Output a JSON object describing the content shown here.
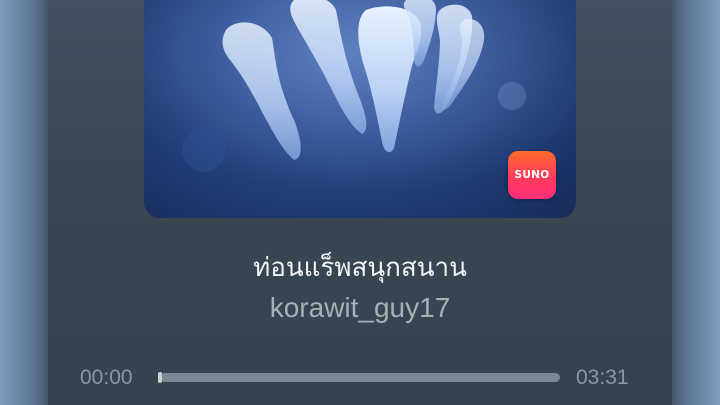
{
  "player": {
    "song_title": "ท่อนแร็พสนุกสนาน",
    "artist": "korawit_guy17",
    "time_current": "00:00",
    "time_total": "03:31",
    "progress_fraction": 0.0,
    "badge_label": "SUNO"
  },
  "colors": {
    "panel": "#3a4653",
    "artwork_base": "#2a4a8c",
    "badge_top": "#ff6a2b",
    "badge_bottom": "#ff2f78",
    "title_text": "#f1f3f6",
    "artist_text": "#a7afb9",
    "track": "#7d8793"
  },
  "icons": {
    "artwork": "teeth-xray-artwork",
    "badge": "suno-app-icon"
  }
}
